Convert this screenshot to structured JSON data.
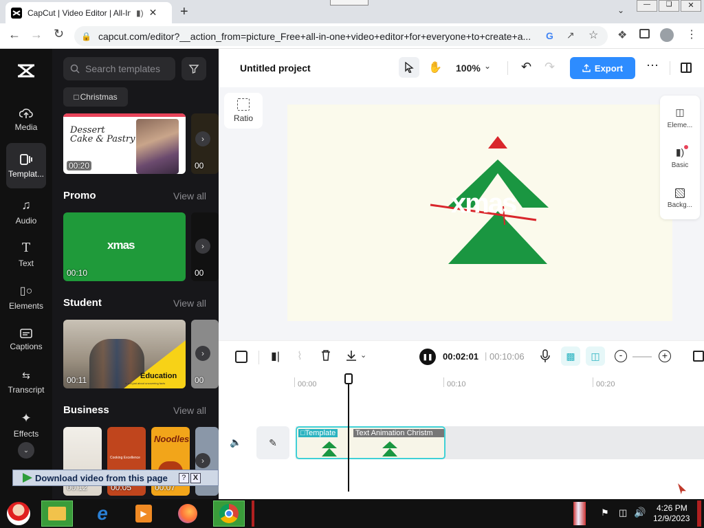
{
  "browser": {
    "tab_title": "CapCut | Video Editor | All-In",
    "url": "capcut.com/editor?__action_from=picture_Free+all-in-one+video+editor+for+everyone+to+create+a..."
  },
  "rail": {
    "items": [
      {
        "label": "Media",
        "icon": "cloud-upload-icon"
      },
      {
        "label": "Templat...",
        "icon": "template-icon"
      },
      {
        "label": "Audio",
        "icon": "music-note-icon"
      },
      {
        "label": "Text",
        "icon": "text-icon"
      },
      {
        "label": "Elements",
        "icon": "elements-icon"
      },
      {
        "label": "Captions",
        "icon": "captions-icon"
      },
      {
        "label": "Transcript",
        "icon": "transcript-icon"
      },
      {
        "label": "Effects",
        "icon": "effects-icon"
      }
    ]
  },
  "panel": {
    "search_placeholder": "Search templates",
    "chip": "Christmas",
    "top_card": {
      "title_line1": "Dessert",
      "title_line2": "Cake & Pastry",
      "duration": "00:20",
      "duration_peek": "00"
    },
    "sections": [
      {
        "title": "Promo",
        "view_all": "View all",
        "duration": "00:10",
        "duration_peek": "00",
        "thumb_text": "xmas"
      },
      {
        "title": "Student",
        "view_all": "View all",
        "duration": "00:11",
        "duration_peek": "00",
        "thumb_text": "Education",
        "thumb_sub": "is not just about uncovering facts"
      },
      {
        "title": "Business",
        "view_all": "View all",
        "durations": [
          "00:12",
          "00:05",
          "00:07"
        ],
        "thumb_texts": [
          "Noodles",
          "Cooking Excellence"
        ]
      }
    ]
  },
  "editor": {
    "project_title": "Untitled project",
    "zoom": "100%",
    "export_label": "Export",
    "ratio_label": "Ratio",
    "right_panel": [
      "Eleme...",
      "Basic",
      "Backg..."
    ],
    "canvas_text": "xmas"
  },
  "timeline": {
    "current_time": "00:02:01",
    "total_time": "00:10:06",
    "ruler": [
      "00:00",
      "00:10",
      "00:20"
    ],
    "clip_labels": [
      "Template",
      "Text Animation Christm"
    ]
  },
  "download_bar": {
    "label": "Download video from this page",
    "help": "?",
    "close": "X"
  },
  "taskbar": {
    "time": "4:26 PM",
    "date": "12/9/2023"
  },
  "colors": {
    "accent": "#2d8cff",
    "green": "#1a9641",
    "red": "#d9262c",
    "clip_border": "#3fd0d6"
  }
}
